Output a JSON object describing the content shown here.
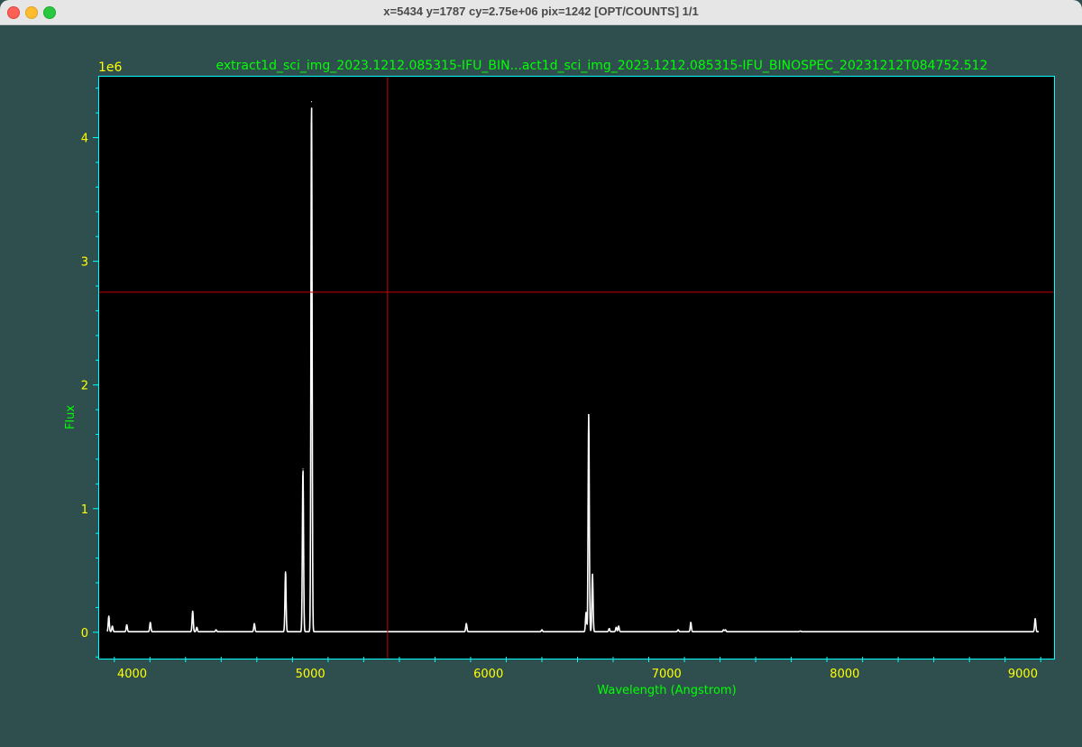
{
  "window": {
    "title": "x=5434  y=1787  cy=2.75e+06  pix=1242  [OPT/COUNTS]  1/1"
  },
  "colors": {
    "background": "#2f4f4f",
    "plot_bg": "#000000",
    "axes_frame": "#00ffff",
    "label_text": "#00ff00",
    "tick_text": "#ffff00",
    "line": "#ffffff",
    "crosshair": "#cc0000"
  },
  "chart_data": {
    "type": "line",
    "title": "extract1d_sci_img_2023.1212.085315-IFU_BIN...act1d_sci_img_2023.1212.085315-IFU_BINOSPEC_20231212T084752.512",
    "xlabel": "Wavelength (Angstrom)",
    "ylabel": "Flux",
    "y_offset_label": "1e6",
    "xlim": [
      3810,
      9180
    ],
    "ylim": [
      -0.22,
      4.5
    ],
    "y_scale": 1000000,
    "xticks": [
      4000,
      5000,
      6000,
      7000,
      8000,
      9000
    ],
    "yticks": [
      0,
      1,
      2,
      3,
      4
    ],
    "crosshair": {
      "x": 5434,
      "y": 2.75
    },
    "continuum": 0.005,
    "lines": [
      {
        "x": 3869,
        "y": 0.13
      },
      {
        "x": 3889,
        "y": 0.05
      },
      {
        "x": 3970,
        "y": 0.06
      },
      {
        "x": 4102,
        "y": 0.08
      },
      {
        "x": 4340,
        "y": 0.17
      },
      {
        "x": 4363,
        "y": 0.04
      },
      {
        "x": 4471,
        "y": 0.02
      },
      {
        "x": 4686,
        "y": 0.07
      },
      {
        "x": 4861,
        "y": 0.49
      },
      {
        "x": 4959,
        "y": 1.32
      },
      {
        "x": 5007,
        "y": 4.29
      },
      {
        "x": 5876,
        "y": 0.07
      },
      {
        "x": 6300,
        "y": 0.02
      },
      {
        "x": 6548,
        "y": 0.16
      },
      {
        "x": 6563,
        "y": 1.76
      },
      {
        "x": 6584,
        "y": 0.47
      },
      {
        "x": 6678,
        "y": 0.03
      },
      {
        "x": 6717,
        "y": 0.04
      },
      {
        "x": 6731,
        "y": 0.05
      },
      {
        "x": 7065,
        "y": 0.02
      },
      {
        "x": 7136,
        "y": 0.08
      },
      {
        "x": 7320,
        "y": 0.02
      },
      {
        "x": 7330,
        "y": 0.02
      },
      {
        "x": 7751,
        "y": 0.01
      },
      {
        "x": 9069,
        "y": 0.11
      }
    ]
  }
}
